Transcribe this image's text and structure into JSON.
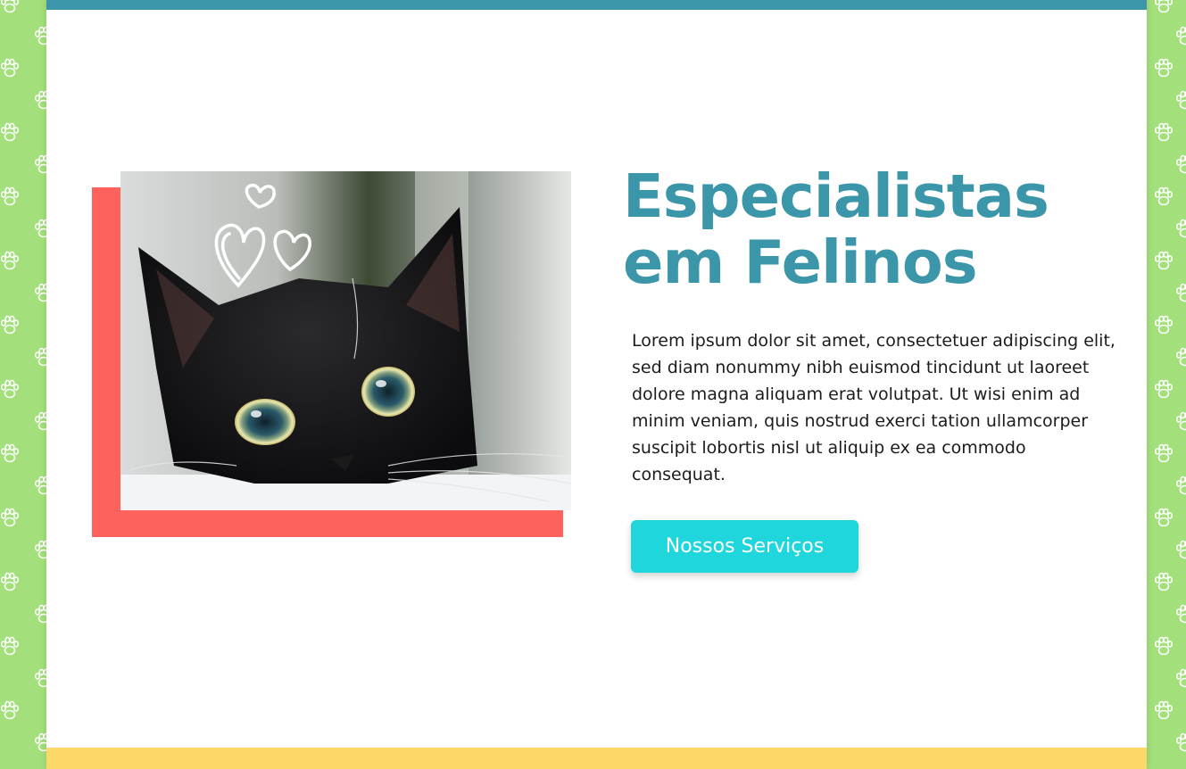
{
  "hero": {
    "headline_line1": "Especialistas",
    "headline_line2": "em Felinos",
    "description": "Lorem ipsum dolor sit amet, consectetuer adipiscing elit, sed diam nonummy nibh euismod tincidunt ut laoreet dolore magna aliquam erat volutpat. Ut wisi enim ad minim veniam, quis nostrud exerci tation ullamcorper suscipit lobortis nisl ut aliquip ex ea commodo consequat.",
    "cta_label": "Nossos Serviços",
    "image_icon": "black-cat-photo"
  },
  "decor": {
    "side_pattern_icon": "paw-print-icon",
    "heart_doodle_icon": "heart-doodle-icon"
  },
  "colors": {
    "background_green": "#a3df7a",
    "top_bar": "#3a96a8",
    "bottom_bar": "#fbd867",
    "headline": "#3a96a8",
    "accent_frame": "#fe625d",
    "cta_button": "#1ed6dc"
  }
}
